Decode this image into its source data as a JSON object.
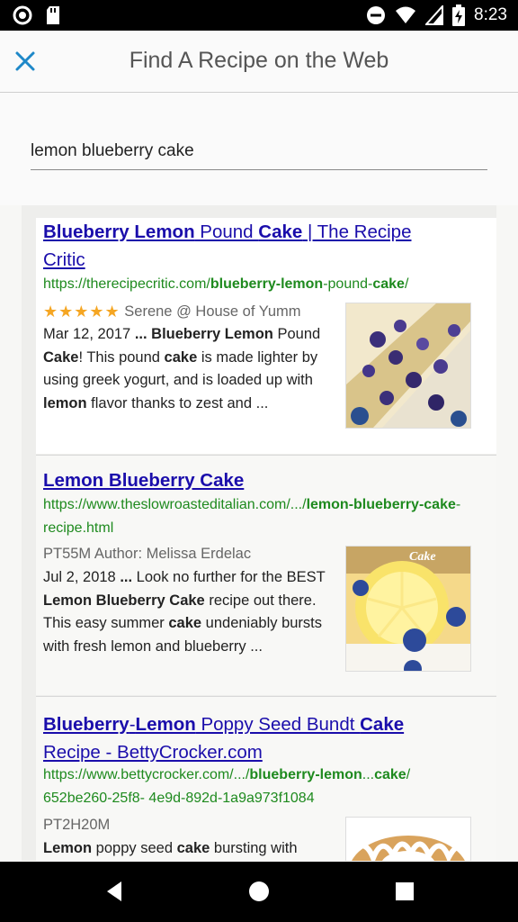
{
  "status": {
    "time": "8:23"
  },
  "appbar": {
    "title": "Find A Recipe on the Web"
  },
  "search": {
    "value": "lemon blueberry cake",
    "placeholder": ""
  },
  "results": [
    {
      "title_parts": [
        {
          "t": "Blueberry Lemon",
          "b": true
        },
        {
          "t": " Pound ",
          "b": false
        },
        {
          "t": "Cake",
          "b": true
        },
        {
          "t": " | The Recipe Critic",
          "b": false
        }
      ],
      "url_parts": [
        {
          "t": "https://therecipecritic.com/",
          "b": false
        },
        {
          "t": "blueberry-lemon",
          "b": true
        },
        {
          "t": "-pound-",
          "b": false
        },
        {
          "t": "cake",
          "b": true
        },
        {
          "t": "/",
          "b": false
        }
      ],
      "stars": "★★★★★",
      "meta": "Serene @ House of Yumm",
      "snippet_parts": [
        {
          "t": "Mar 12, 2017 ",
          "b": false
        },
        {
          "t": "...",
          "b": true
        },
        {
          "t": " ",
          "b": false
        },
        {
          "t": "Blueberry Lemon",
          "b": true
        },
        {
          "t": " Pound ",
          "b": false
        },
        {
          "t": "Cake",
          "b": true
        },
        {
          "t": "! This pound ",
          "b": false
        },
        {
          "t": "cake",
          "b": true
        },
        {
          "t": " is made lighter by using greek yogurt, and is loaded up with ",
          "b": false
        },
        {
          "t": "lemon",
          "b": true
        },
        {
          "t": " flavor thanks to zest and ...",
          "b": false
        }
      ]
    },
    {
      "title_parts": [
        {
          "t": "Lemon Blueberry Cake",
          "b": true
        }
      ],
      "url_parts": [
        {
          "t": "https://www.theslowroasteditalian.com/.../",
          "b": false
        },
        {
          "t": "lemon-blueberry-cake",
          "b": true
        },
        {
          "t": "-recipe.html",
          "b": false
        }
      ],
      "stars": "",
      "meta": "PT55M Author: Melissa Erdelac",
      "snippet_parts": [
        {
          "t": "Jul 2, 2018 ",
          "b": false
        },
        {
          "t": "...",
          "b": true
        },
        {
          "t": " Look no further for the BEST ",
          "b": false
        },
        {
          "t": "Lemon Blueberry Cake",
          "b": true
        },
        {
          "t": " recipe out there. This easy summer ",
          "b": false
        },
        {
          "t": "cake",
          "b": true
        },
        {
          "t": " undeniably bursts with fresh lemon and blueberry ...",
          "b": false
        }
      ],
      "thumb_label": "Cake"
    },
    {
      "title_parts": [
        {
          "t": "Blueberry",
          "b": true
        },
        {
          "t": "-",
          "b": false
        },
        {
          "t": "Lemon",
          "b": true
        },
        {
          "t": " Poppy Seed Bundt ",
          "b": false
        },
        {
          "t": "Cake",
          "b": true
        },
        {
          "t": " Recipe - BettyCrocker.com",
          "b": false
        }
      ],
      "url_parts": [
        {
          "t": "https://www.bettycrocker.com/.../",
          "b": false
        },
        {
          "t": "blueberry-lemon",
          "b": true
        },
        {
          "t": "...",
          "b": false
        },
        {
          "t": "cake",
          "b": true
        },
        {
          "t": "/ 652be260-25f8- 4e9d-892d-1a9a973f1084",
          "b": false
        }
      ],
      "stars": "",
      "meta": "PT2H20M",
      "snippet_parts": [
        {
          "t": "Lemon",
          "b": true
        },
        {
          "t": " poppy seed ",
          "b": false
        },
        {
          "t": "cake",
          "b": true
        },
        {
          "t": " bursting with",
          "b": false
        }
      ]
    }
  ],
  "colors": {
    "link": "#1a0dab",
    "url": "#1e8a1e",
    "close_icon": "#1e88c8",
    "star": "#f5a623"
  }
}
